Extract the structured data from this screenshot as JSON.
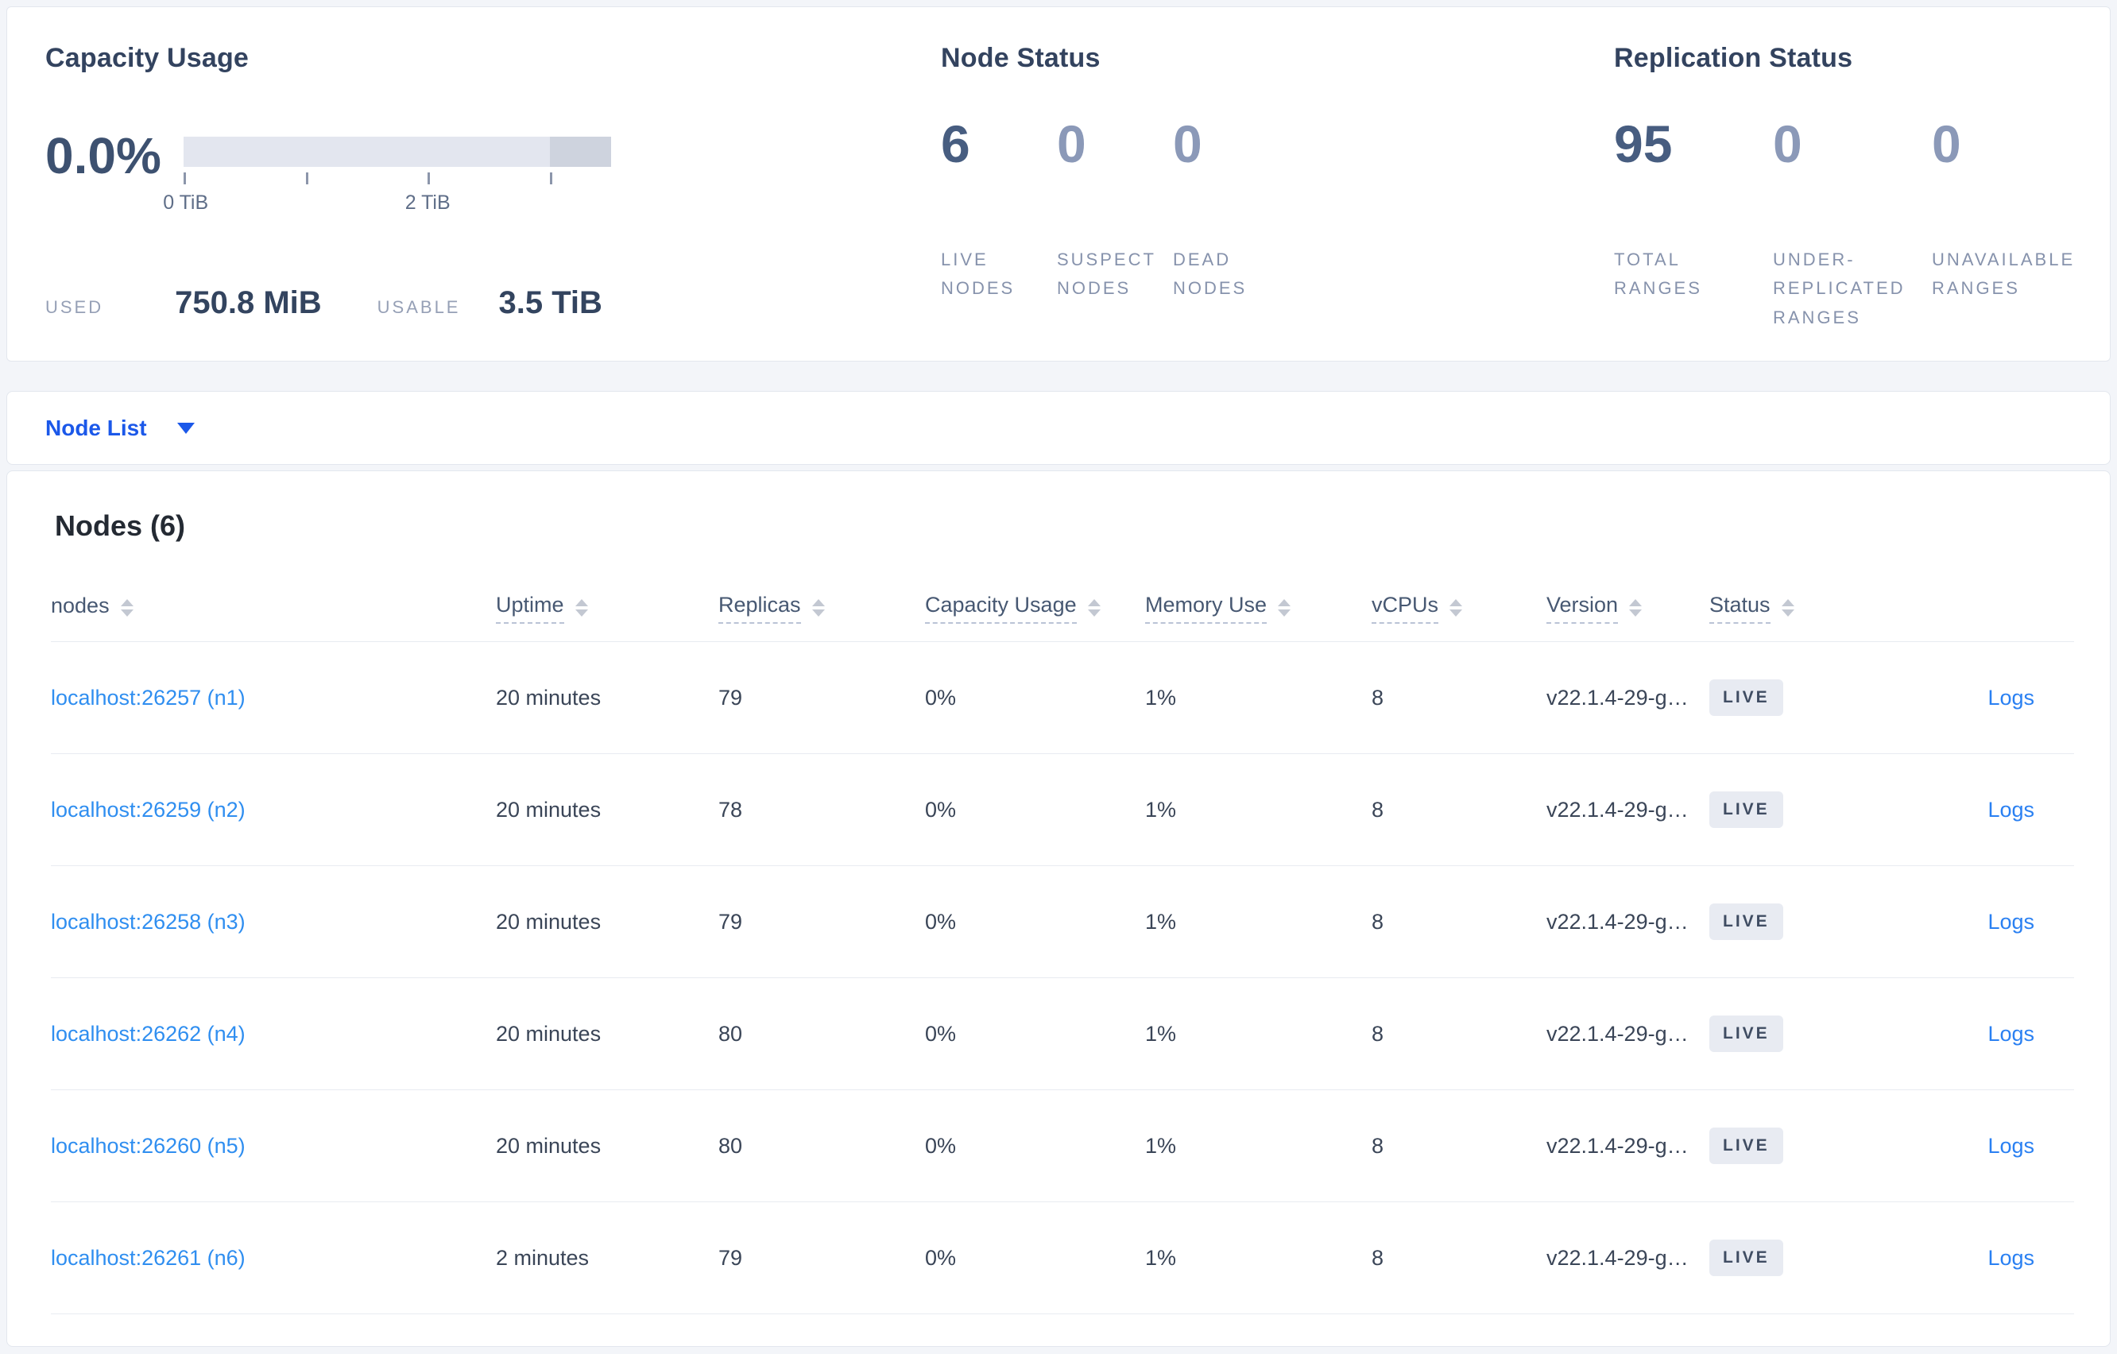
{
  "colors": {
    "accent_blue": "#1b58e9",
    "node_link_blue": "#2f8ef0",
    "logs_link_blue": "#2a80f2",
    "badge_bg": "#e8ebf2",
    "bar_track": "#e3e6ef",
    "bar_dark_segment": "#ced3de"
  },
  "summary": {
    "capacity": {
      "title": "Capacity Usage",
      "percent": "0.0%",
      "tick_label_start": "0 TiB",
      "tick_label_mid": "2 TiB",
      "used_label": "USED",
      "used_value": "750.8 MiB",
      "usable_label": "USABLE",
      "usable_value": "3.5 TiB"
    },
    "node_status": {
      "title": "Node Status",
      "stats": [
        {
          "value": "6",
          "label": "LIVE NODES"
        },
        {
          "value": "0",
          "label": "SUSPECT NODES"
        },
        {
          "value": "0",
          "label": "DEAD NODES"
        }
      ]
    },
    "replication": {
      "title": "Replication Status",
      "stats": [
        {
          "value": "95",
          "label": "TOTAL RANGES"
        },
        {
          "value": "0",
          "label": "UNDER-REPLICATED RANGES"
        },
        {
          "value": "0",
          "label": "UNAVAILABLE RANGES"
        }
      ]
    }
  },
  "view_selector": {
    "label": "Node List"
  },
  "table": {
    "title": "Nodes (6)",
    "logs_label": "Logs",
    "columns": [
      {
        "label": "nodes"
      },
      {
        "label": "Uptime"
      },
      {
        "label": "Replicas"
      },
      {
        "label": "Capacity Usage"
      },
      {
        "label": "Memory Use"
      },
      {
        "label": "vCPUs"
      },
      {
        "label": "Version"
      },
      {
        "label": "Status"
      }
    ],
    "rows": [
      {
        "name": "localhost:26257 (n1)",
        "uptime": "20 minutes",
        "replicas": "79",
        "capacity": "0%",
        "memory": "1%",
        "vcpus": "8",
        "version": "v22.1.4-29-g…",
        "status": "LIVE"
      },
      {
        "name": "localhost:26259 (n2)",
        "uptime": "20 minutes",
        "replicas": "78",
        "capacity": "0%",
        "memory": "1%",
        "vcpus": "8",
        "version": "v22.1.4-29-g…",
        "status": "LIVE"
      },
      {
        "name": "localhost:26258 (n3)",
        "uptime": "20 minutes",
        "replicas": "79",
        "capacity": "0%",
        "memory": "1%",
        "vcpus": "8",
        "version": "v22.1.4-29-g…",
        "status": "LIVE"
      },
      {
        "name": "localhost:26262 (n4)",
        "uptime": "20 minutes",
        "replicas": "80",
        "capacity": "0%",
        "memory": "1%",
        "vcpus": "8",
        "version": "v22.1.4-29-g…",
        "status": "LIVE"
      },
      {
        "name": "localhost:26260 (n5)",
        "uptime": "20 minutes",
        "replicas": "80",
        "capacity": "0%",
        "memory": "1%",
        "vcpus": "8",
        "version": "v22.1.4-29-g…",
        "status": "LIVE"
      },
      {
        "name": "localhost:26261 (n6)",
        "uptime": "2 minutes",
        "replicas": "79",
        "capacity": "0%",
        "memory": "1%",
        "vcpus": "8",
        "version": "v22.1.4-29-g…",
        "status": "LIVE"
      }
    ]
  }
}
